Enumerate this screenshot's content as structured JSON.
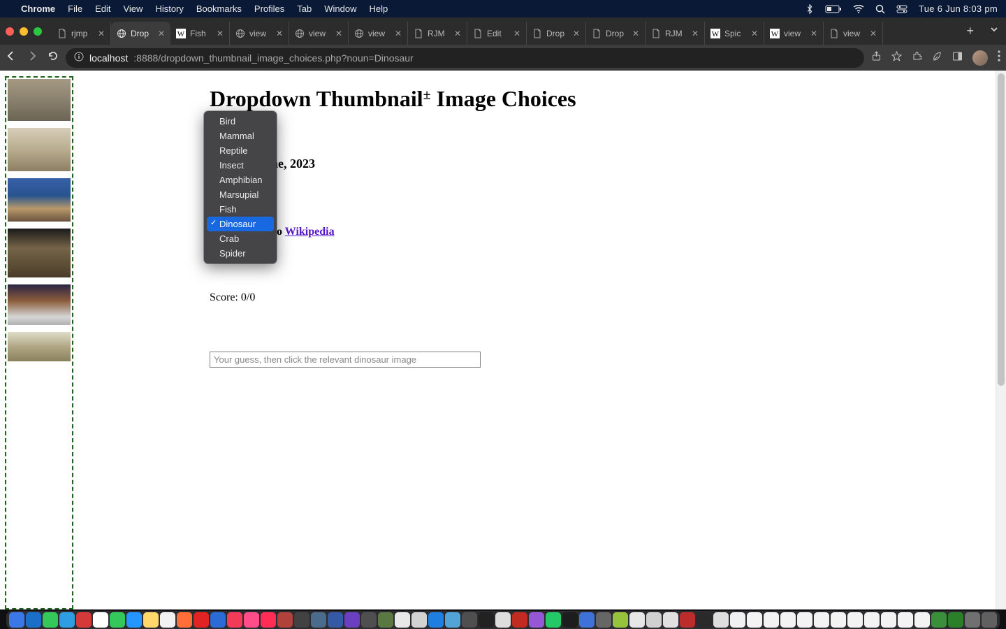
{
  "menubar": {
    "appname": "Chrome",
    "items": [
      "File",
      "Edit",
      "View",
      "History",
      "Bookmarks",
      "Profiles",
      "Tab",
      "Window",
      "Help"
    ],
    "clock": "Tue 6 Jun  8:03 pm"
  },
  "tabs": [
    {
      "title": "rjmp",
      "fav": "file"
    },
    {
      "title": "Drop",
      "fav": "globe",
      "active": true
    },
    {
      "title": "Fish",
      "fav": "W"
    },
    {
      "title": "view",
      "fav": "globe"
    },
    {
      "title": "view",
      "fav": "globe"
    },
    {
      "title": "view",
      "fav": "globe"
    },
    {
      "title": "RJM",
      "fav": "file"
    },
    {
      "title": "Edit",
      "fav": "file"
    },
    {
      "title": "Drop",
      "fav": "file"
    },
    {
      "title": "Drop",
      "fav": "file"
    },
    {
      "title": "RJM",
      "fav": "file"
    },
    {
      "title": "Spic",
      "fav": "W"
    },
    {
      "title": "view",
      "fav": "W"
    },
    {
      "title": "view",
      "fav": "file"
    }
  ],
  "addressbar": {
    "host": "localhost",
    "rest": ":8888/dropdown_thumbnail_image_choices.php?noun=Dinosaur"
  },
  "page": {
    "title_pre": "Dropdown Thumbnail",
    "title_sup": "±",
    "title_post": " Image Choices",
    "subhead_obscured": "mming - June, 2023",
    "quiz_prefix": "uiz ... thanks to ",
    "quiz_link_text": "Wikipedia",
    "score_label": "Score: ",
    "score_value": "0/0",
    "input_placeholder": "Your guess, then click the relevant dinosaur image"
  },
  "dropdown": {
    "items": [
      "Bird",
      "Mammal",
      "Reptile",
      "Insect",
      "Amphibian",
      "Marsupial",
      "Fish",
      "Dinosaur",
      "Crab",
      "Spider"
    ],
    "selected": "Dinosaur"
  }
}
